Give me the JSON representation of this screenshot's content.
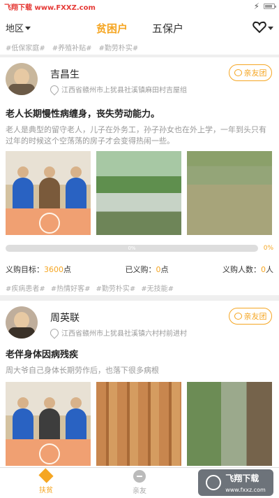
{
  "status_bar": {
    "watermark": "飞翔下载 www.FXXZ.com"
  },
  "header": {
    "region_label": "地区",
    "tabs": [
      {
        "label": "贫困户"
      },
      {
        "label": "五保户"
      }
    ]
  },
  "filter_tags": [
    "#低保家庭#",
    "#养殖补贴#",
    "#勤劳朴实#"
  ],
  "cards": [
    {
      "name": "吉昌生",
      "location": "江西省赣州市上犹县社溪镇麻田村吉屋组",
      "relatives_button": "亲友团",
      "headline": "老人长期慢性病缠身，丧失劳动能力。",
      "description": "老人是典型的留守老人，儿子在外务工，孙子孙女也在外上学，一年到头只有过年的时候这个空荡荡的房子才会变得热闹一些。",
      "progress": {
        "value": 0,
        "label": "0%",
        "percent_text": "0%"
      },
      "stats": {
        "target_label": "义购目标：",
        "target_value": "3600",
        "target_unit": "点",
        "purchased_label": "已义购：",
        "purchased_value": "0",
        "purchased_unit": "点",
        "count_label": "义购人数：",
        "count_value": "0",
        "count_unit": "人"
      },
      "tags": [
        "#疾病患者#",
        "#热情好客#",
        "#勤劳朴实#",
        "#无技能#"
      ]
    },
    {
      "name": "周英联",
      "location": "江西省赣州市上犹县社溪镇六村村前进村",
      "relatives_button": "亲友团",
      "headline": "老伴身体因病残疾",
      "description": "周大爷自己身体长期劳作后，也落下很多病根"
    }
  ],
  "bottom_nav": {
    "help_label": "扶贫",
    "friends_label": "亲友",
    "logo_text": "飞翔下载",
    "logo_subtext": "www.fxxz.com"
  },
  "colors": {
    "accent": "#f5a623"
  }
}
